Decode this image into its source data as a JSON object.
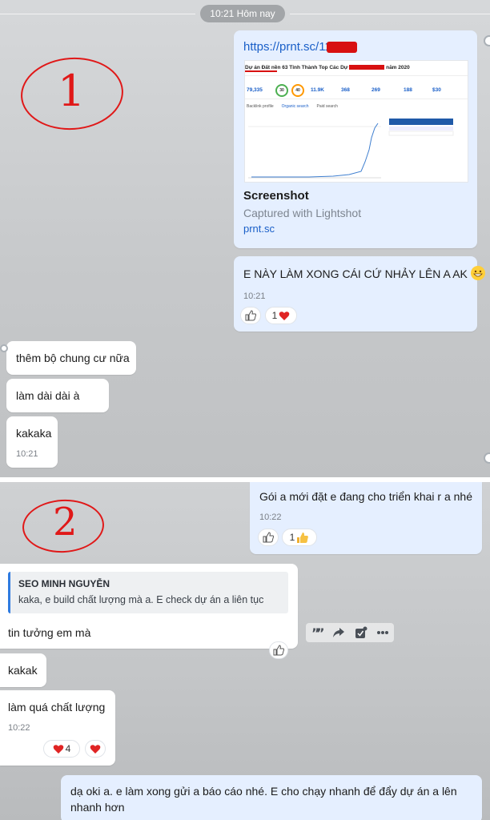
{
  "panel1": {
    "date_divider": "10:21 Hôm nay",
    "annotation_number": "1",
    "link_card": {
      "url": "https://prnt.sc/115",
      "thumbnail_title": "Dự án Đất nền 63 Tỉnh Thành Top Các Dự",
      "thumbnail_year": "năm 2020",
      "thumbnail_stats": [
        "79,335",
        "30",
        "40",
        "11.9K",
        "368",
        "269",
        "188",
        "$30"
      ],
      "thumbnail_tabs": [
        "Backlink profile",
        "Organic search",
        "Paid search"
      ],
      "title": "Screenshot",
      "subtitle": "Captured with Lightshot",
      "domain": "prnt.sc"
    },
    "my_message": {
      "text": "E NÀY LÀM XONG CÁI CỨ NHẢY LÊN A AK",
      "time": "10:21",
      "reaction_count": "1"
    },
    "incoming": [
      {
        "text": "thêm bộ chung cư nữa"
      },
      {
        "text": "làm dài dài à"
      },
      {
        "text": "kakaka",
        "time": "10:21"
      }
    ]
  },
  "panel2": {
    "annotation_number": "2",
    "my_message_top": {
      "text": "Gói a mới đặt e đang cho triển khai r a nhé",
      "time": "10:22",
      "reaction_count": "1"
    },
    "quoted_reply": {
      "author": "SEO MINH NGUYỄN",
      "quote": "kaka, e build chất lượng mà a. E check dự án a liên tục",
      "text": "tin tưởng em mà"
    },
    "incoming": [
      {
        "text": "kakak"
      },
      {
        "text": "làm quá chất lượng",
        "time": "10:22",
        "reaction_count": "4"
      }
    ],
    "my_message_bottom": {
      "text": "dạ oki a. e làm xong gửi a báo cáo nhé. E cho chạy nhanh để đẩy dự án a lên nhanh hơn"
    },
    "action_icons": [
      "quote-icon",
      "forward-icon",
      "task-icon",
      "more-icon"
    ]
  },
  "colors": {
    "my_bubble": "#e5efff",
    "their_bubble": "#ffffff",
    "annotation": "#e01818",
    "link": "#1a5fc8"
  }
}
